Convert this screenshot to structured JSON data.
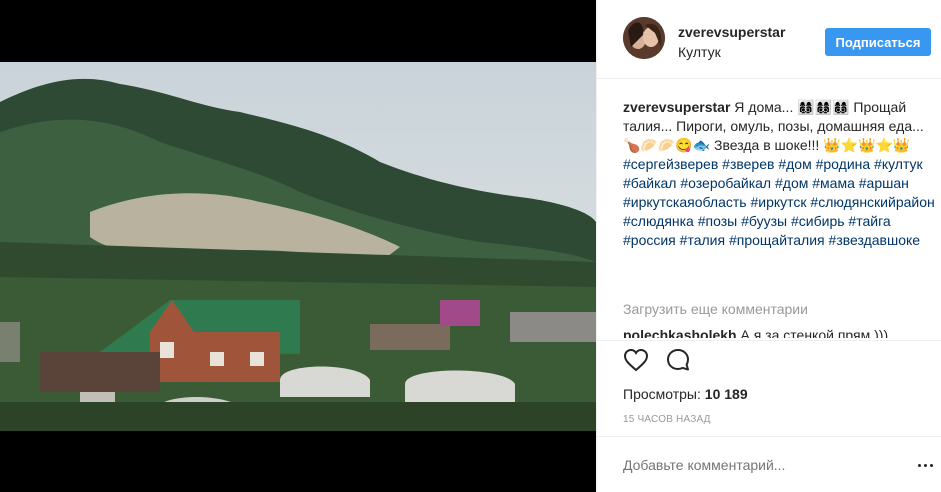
{
  "post": {
    "username": "zverevsuperstar",
    "location": "Култук",
    "follow_label": "Подписаться"
  },
  "caption": {
    "username": "zverevsuperstar",
    "text_1": " Я дома... 👩‍👩‍👦‍👦👩‍👩‍👦‍👦👩‍👩‍👦‍👦 Прощай талия... Пироги, омуль, позы, домашняя еда... 🍗🥟🥟😋🐟 Звезда в шоке!!! 👑⭐👑⭐👑 ",
    "hashtags": [
      "#сергейзверев",
      "#зверев",
      "#дом",
      "#родина",
      "#култук",
      "#байкал",
      "#озеробайкал",
      "#дом",
      "#мама",
      "#аршан",
      "#иркутскаяобласть",
      "#иркутск",
      "#слюдянскийрайон",
      "#слюдянка",
      "#позы",
      "#буузы",
      "#сибирь",
      "#тайга",
      "#россия",
      "#талия",
      "#прощайталия",
      "#звездавшоке"
    ]
  },
  "comments": {
    "load_more": "Загрузить еще комментарии",
    "first_username": "polechkasholekh",
    "first_text": " А я за стенкой прям )))"
  },
  "stats": {
    "views_label": "Просмотры:",
    "views_count": "10 189",
    "time_ago": "15 ЧАСОВ НАЗАД"
  },
  "add_comment": {
    "placeholder": "Добавьте комментарий..."
  },
  "icons": {
    "like": "heart-icon",
    "comment": "comment-bubble-icon",
    "more": "more-options-icon"
  },
  "colors": {
    "follow_button": "#3897f0",
    "hashtag": "#003569",
    "muted": "#999999"
  }
}
